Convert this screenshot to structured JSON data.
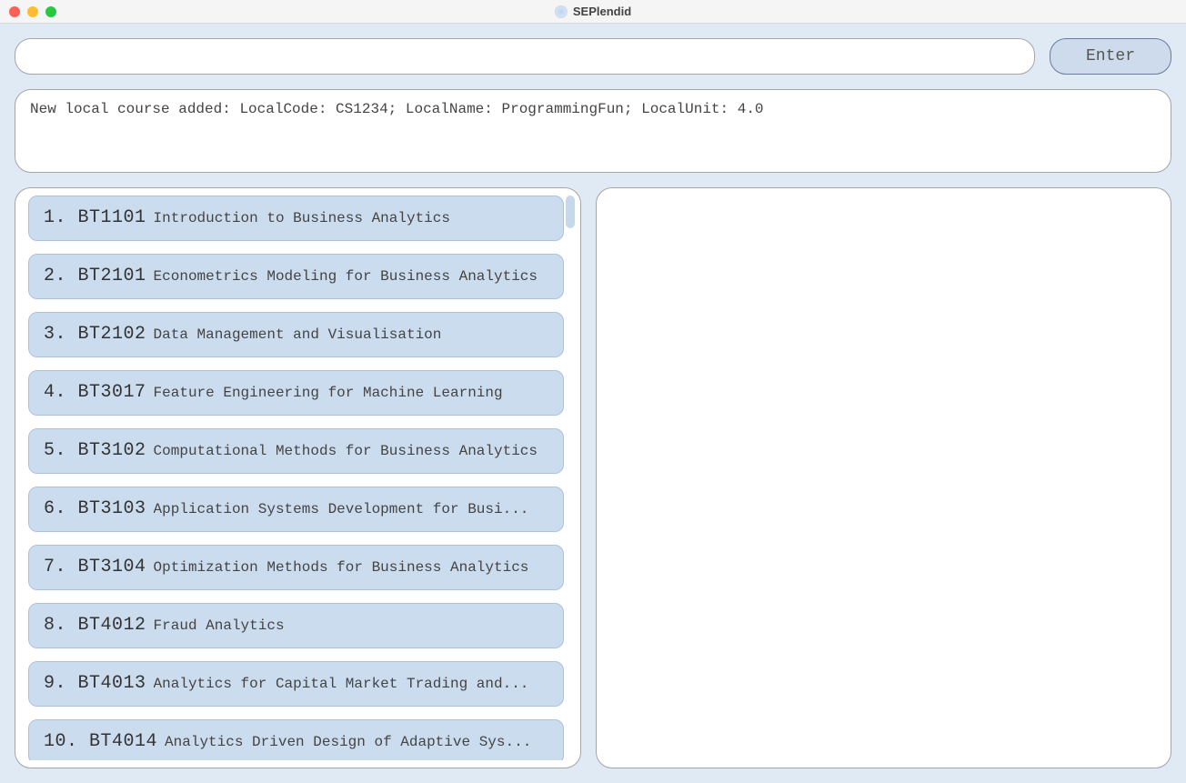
{
  "window": {
    "title": "SEPlendid"
  },
  "input": {
    "value": "",
    "placeholder": ""
  },
  "enter_button_label": "Enter",
  "message": "New local course added: LocalCode: CS1234; LocalName: ProgrammingFun; LocalUnit: 4.0",
  "courses": [
    {
      "index": "1.",
      "code": "BT1101",
      "name": "Introduction to Business Analytics"
    },
    {
      "index": "2.",
      "code": "BT2101",
      "name": "Econometrics Modeling for Business Analytics"
    },
    {
      "index": "3.",
      "code": "BT2102",
      "name": "Data Management and Visualisation"
    },
    {
      "index": "4.",
      "code": "BT3017",
      "name": "Feature Engineering for Machine Learning"
    },
    {
      "index": "5.",
      "code": "BT3102",
      "name": "Computational Methods for Business Analytics"
    },
    {
      "index": "6.",
      "code": "BT3103",
      "name": "Application Systems Development for Busi..."
    },
    {
      "index": "7.",
      "code": "BT3104",
      "name": "Optimization Methods for Business Analytics"
    },
    {
      "index": "8.",
      "code": "BT4012",
      "name": "Fraud Analytics"
    },
    {
      "index": "9.",
      "code": "BT4013",
      "name": "Analytics for Capital Market Trading and..."
    },
    {
      "index": "10.",
      "code": "BT4014",
      "name": "Analytics Driven Design of Adaptive Sys..."
    }
  ]
}
